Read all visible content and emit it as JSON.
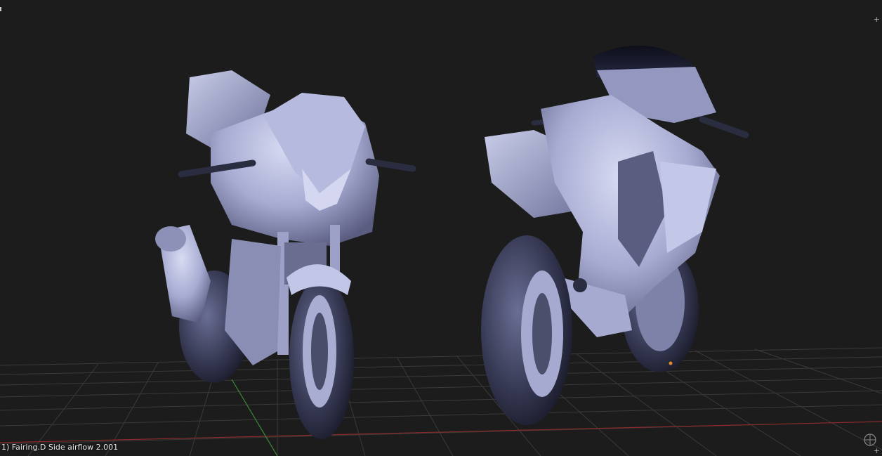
{
  "viewport": {
    "active_object_label": "1) Fairing.D Side airflow 2.001",
    "background_color": "#1c1c1c",
    "grid_color": "#3a3a3a",
    "x_axis_color": "#8a2a2a",
    "y_axis_color": "#3a8a3a",
    "model_color": "#a8acd4"
  },
  "icons": {
    "corner_top_right": "+",
    "corner_bottom_right": "+",
    "gizmo": "view-gizmo-icon"
  }
}
